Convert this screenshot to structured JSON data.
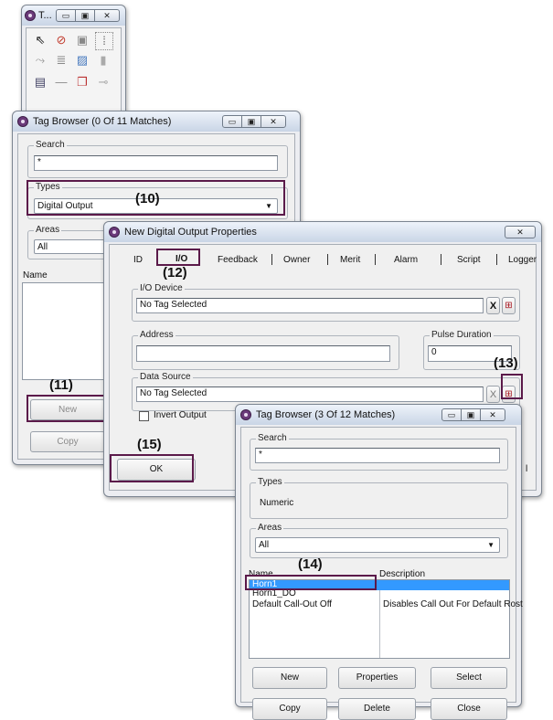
{
  "toolbox": {
    "title": "T...",
    "tools": [
      {
        "icon": "pointer-icon",
        "glyph": "⇖"
      },
      {
        "icon": "delete-icon",
        "glyph": "⊘"
      },
      {
        "icon": "shape-icon",
        "glyph": "▣"
      },
      {
        "icon": "grid-icon",
        "glyph": "⁞"
      },
      {
        "icon": "wire-icon",
        "glyph": "⤳"
      },
      {
        "icon": "text-icon",
        "glyph": "≣"
      },
      {
        "icon": "image-icon",
        "glyph": "▨"
      },
      {
        "icon": "trash-icon",
        "glyph": "▮"
      },
      {
        "icon": "form-icon",
        "glyph": "▤"
      },
      {
        "icon": "line-icon",
        "glyph": "—"
      },
      {
        "icon": "copy-icon",
        "glyph": "❐"
      },
      {
        "icon": "key-icon",
        "glyph": "⊸"
      }
    ]
  },
  "tag_browser_back": {
    "title": "Tag Browser (0 Of 11 Matches)",
    "search_label": "Search",
    "search_value": "*",
    "types_label": "Types",
    "types_value": "Digital Output",
    "areas_label": "Areas",
    "areas_value": "All",
    "name_header": "Name",
    "new_button": "New",
    "copy_button": "Copy"
  },
  "properties": {
    "title": "New Digital Output Properties",
    "tabs": [
      "ID",
      "I/O",
      "Feedback",
      "Owner",
      "Merit",
      "Alarm",
      "Script",
      "Logger"
    ],
    "io_device_label": "I/O Device",
    "io_device_value": "No Tag Selected",
    "address_label": "Address",
    "address_value": "",
    "pulse_label": "Pulse Duration",
    "pulse_value": "0",
    "data_source_label": "Data Source",
    "data_source_value": "No Tag Selected",
    "invert_label": "Invert Output",
    "ok_button": "OK",
    "clear_glyph": "X",
    "cancel_fragment": "l"
  },
  "tag_browser_front": {
    "title": "Tag Browser (3 Of 12 Matches)",
    "search_label": "Search",
    "search_value": "*",
    "types_label": "Types",
    "types_value": "Numeric",
    "areas_label": "Areas",
    "areas_value": "All",
    "name_header": "Name",
    "desc_header": "Description",
    "rows": [
      {
        "name": "Horn1",
        "description": ""
      },
      {
        "name": "Horn1_DO",
        "description": ""
      },
      {
        "name": "Default Call-Out Off",
        "description": "Disables Call Out For Default Rost"
      }
    ],
    "buttons": [
      "New",
      "Properties",
      "Select",
      "Copy",
      "Delete",
      "Close"
    ]
  },
  "callouts": [
    "(10)",
    "(11)",
    "(12)",
    "(13)",
    "(14)",
    "(15)"
  ],
  "colors": {
    "highlight": "#5b1a4a",
    "selection": "#3399ff"
  }
}
